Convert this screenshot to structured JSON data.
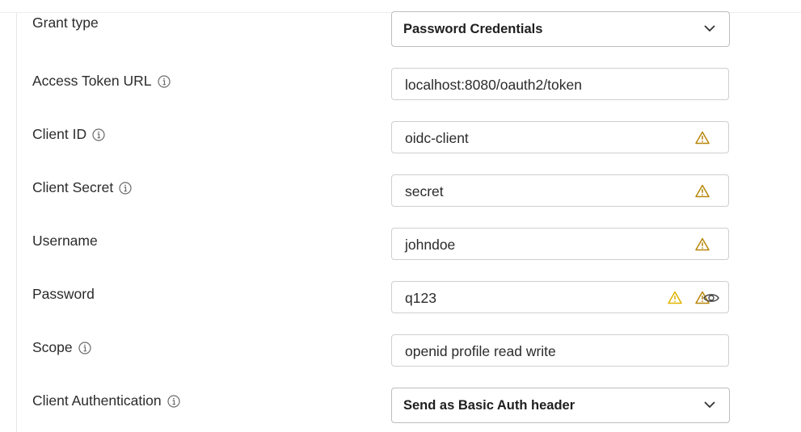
{
  "rows": [
    {
      "label": "Grant type",
      "type": "select",
      "value": "Password Credentials",
      "icons": [
        "chevron-down"
      ]
    },
    {
      "label": "Access Token URL",
      "info": true,
      "type": "input",
      "value": "localhost:8080/oauth2/token",
      "icons": []
    },
    {
      "label": "Client ID",
      "info": true,
      "type": "input",
      "value": "oidc-client",
      "icons": [
        "warning"
      ]
    },
    {
      "label": "Client Secret",
      "info": true,
      "type": "input",
      "value": "secret",
      "icons": [
        "warning"
      ]
    },
    {
      "label": "Username",
      "type": "input",
      "value": "johndoe",
      "icons": [
        "warning"
      ]
    },
    {
      "label": "Password",
      "type": "input",
      "value": "q123",
      "icons": [
        "warning",
        "warning",
        "eye"
      ]
    },
    {
      "label": "Scope",
      "info": true,
      "type": "input",
      "value": "openid profile read write",
      "icons": []
    },
    {
      "label": "Client Authentication",
      "info": true,
      "type": "select",
      "value": "Send as Basic Auth header",
      "icons": [
        "chevron-down"
      ]
    }
  ],
  "colors": {
    "warning_dark": "#b8870b",
    "warning_light": "#e0b400",
    "border": "#cfcfcf",
    "info_icon": "#6b6b6b"
  }
}
